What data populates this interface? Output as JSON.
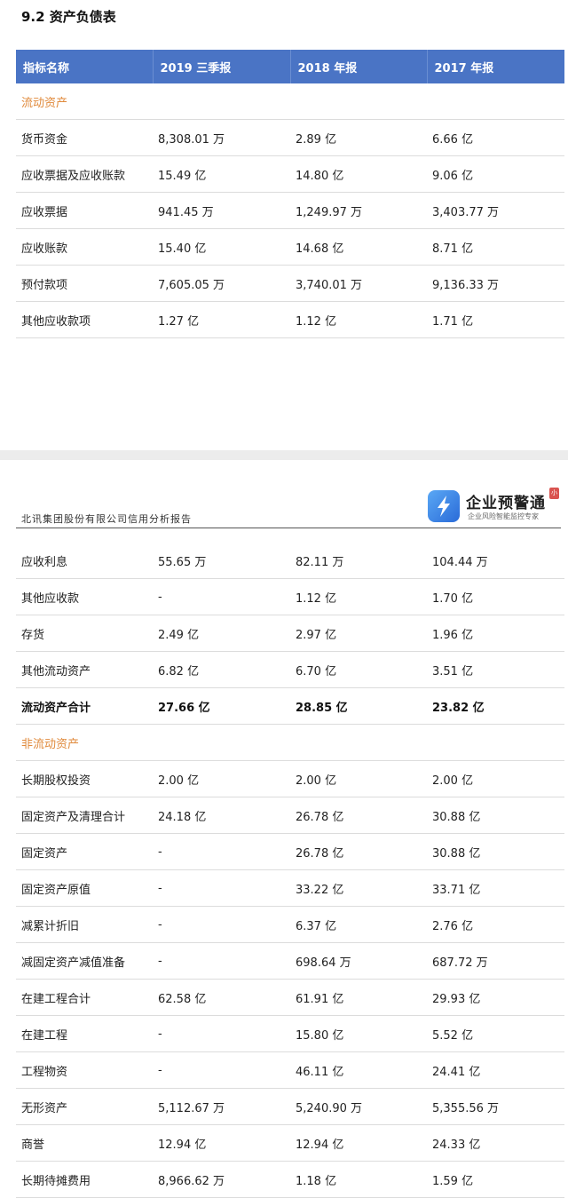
{
  "section_title": "9.2 资产负债表",
  "columns": [
    "指标名称",
    "2019 三季报",
    "2018 年报",
    "2017 年报"
  ],
  "table1": [
    {
      "type": "category",
      "cells": [
        "流动资产",
        "",
        "",
        ""
      ]
    },
    {
      "type": "row",
      "cells": [
        "货币资金",
        "8,308.01 万",
        "2.89 亿",
        "6.66 亿"
      ]
    },
    {
      "type": "row",
      "cells": [
        "应收票据及应收账款",
        "15.49 亿",
        "14.80 亿",
        "9.06 亿"
      ]
    },
    {
      "type": "row",
      "cells": [
        "应收票据",
        "941.45 万",
        "1,249.97 万",
        "3,403.77 万"
      ]
    },
    {
      "type": "row",
      "cells": [
        "应收账款",
        "15.40 亿",
        "14.68 亿",
        "8.71 亿"
      ]
    },
    {
      "type": "row",
      "cells": [
        "预付款项",
        "7,605.05 万",
        "3,740.01 万",
        "9,136.33 万"
      ]
    },
    {
      "type": "row",
      "cells": [
        "其他应收款项",
        "1.27 亿",
        "1.12 亿",
        "1.71 亿"
      ]
    }
  ],
  "header2": {
    "company": "北讯集团股份有限公司信用分析报告",
    "logo_title": "企业预警通",
    "logo_subtitle": "企业风险智能监控专家",
    "stamp": "小"
  },
  "table2": [
    {
      "type": "row",
      "cells": [
        "应收利息",
        "55.65 万",
        "82.11 万",
        "104.44 万"
      ]
    },
    {
      "type": "row",
      "cells": [
        "其他应收款",
        "-",
        "1.12 亿",
        "1.70 亿"
      ]
    },
    {
      "type": "row",
      "cells": [
        "存货",
        "2.49 亿",
        "2.97 亿",
        "1.96 亿"
      ]
    },
    {
      "type": "row",
      "cells": [
        "其他流动资产",
        "6.82 亿",
        "6.70 亿",
        "3.51 亿"
      ]
    },
    {
      "type": "bold",
      "cells": [
        "流动资产合计",
        "27.66 亿",
        "28.85 亿",
        "23.82 亿"
      ]
    },
    {
      "type": "category",
      "cells": [
        "非流动资产",
        "",
        "",
        ""
      ]
    },
    {
      "type": "row",
      "cells": [
        "长期股权投资",
        "2.00 亿",
        "2.00 亿",
        "2.00 亿"
      ]
    },
    {
      "type": "row",
      "cells": [
        "固定资产及清理合计",
        "24.18 亿",
        "26.78 亿",
        "30.88 亿"
      ]
    },
    {
      "type": "row",
      "cells": [
        "固定资产",
        "-",
        "26.78 亿",
        "30.88 亿"
      ]
    },
    {
      "type": "row",
      "cells": [
        "固定资产原值",
        "-",
        "33.22 亿",
        "33.71 亿"
      ]
    },
    {
      "type": "row",
      "cells": [
        "减累计折旧",
        "-",
        "6.37 亿",
        "2.76 亿"
      ]
    },
    {
      "type": "row",
      "cells": [
        "减固定资产减值准备",
        "-",
        "698.64 万",
        "687.72 万"
      ]
    },
    {
      "type": "row",
      "cells": [
        "在建工程合计",
        "62.58 亿",
        "61.91 亿",
        "29.93 亿"
      ]
    },
    {
      "type": "row",
      "cells": [
        "在建工程",
        "-",
        "15.80 亿",
        "5.52 亿"
      ]
    },
    {
      "type": "row",
      "cells": [
        "工程物资",
        "-",
        "46.11 亿",
        "24.41 亿"
      ]
    },
    {
      "type": "row",
      "cells": [
        "无形资产",
        "5,112.67 万",
        "5,240.90 万",
        "5,355.56 万"
      ]
    },
    {
      "type": "row",
      "cells": [
        "商誉",
        "12.94 亿",
        "12.94 亿",
        "24.33 亿"
      ]
    },
    {
      "type": "row",
      "cells": [
        "长期待摊费用",
        "8,966.62 万",
        "1.18 亿",
        "1.59 亿"
      ]
    }
  ],
  "colors": {
    "header_bg": "#4a74c5",
    "category_text": "#e08a3c",
    "border": "#dcdcdc"
  },
  "icons": [
    "lightning-bolt-icon"
  ]
}
